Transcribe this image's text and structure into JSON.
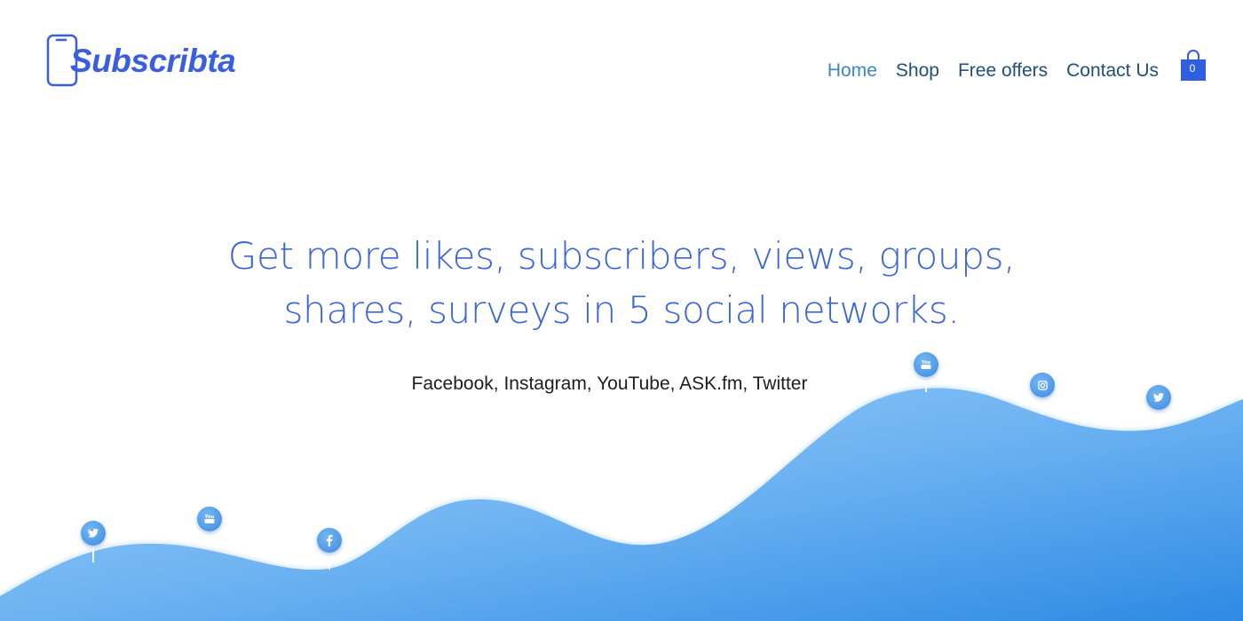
{
  "logo": {
    "text": "Subscribta"
  },
  "nav": {
    "items": [
      {
        "label": "Home",
        "active": true
      },
      {
        "label": "Shop",
        "active": false
      },
      {
        "label": "Free offers",
        "active": false
      },
      {
        "label": "Contact Us",
        "active": false
      }
    ],
    "cart_count": "0"
  },
  "hero": {
    "headline_line1": "Get more likes, subscribers, views, groups,",
    "headline_line2": "shares, surveys in 5 social networks.",
    "networks": "Facebook, Instagram, YouTube, ASK.fm, Twitter"
  },
  "social_markers": [
    {
      "icon": "twitter-icon"
    },
    {
      "icon": "youtube-icon"
    },
    {
      "icon": "facebook-icon"
    },
    {
      "icon": "youtube-icon"
    },
    {
      "icon": "instagram-icon"
    },
    {
      "icon": "twitter-icon"
    }
  ],
  "colors": {
    "brand": "#3a5ee0",
    "nav_text": "#1f4f7a",
    "nav_active": "#3a86c8",
    "wave_light": "#8cc4f6",
    "wave_dark": "#2f8ae4"
  }
}
